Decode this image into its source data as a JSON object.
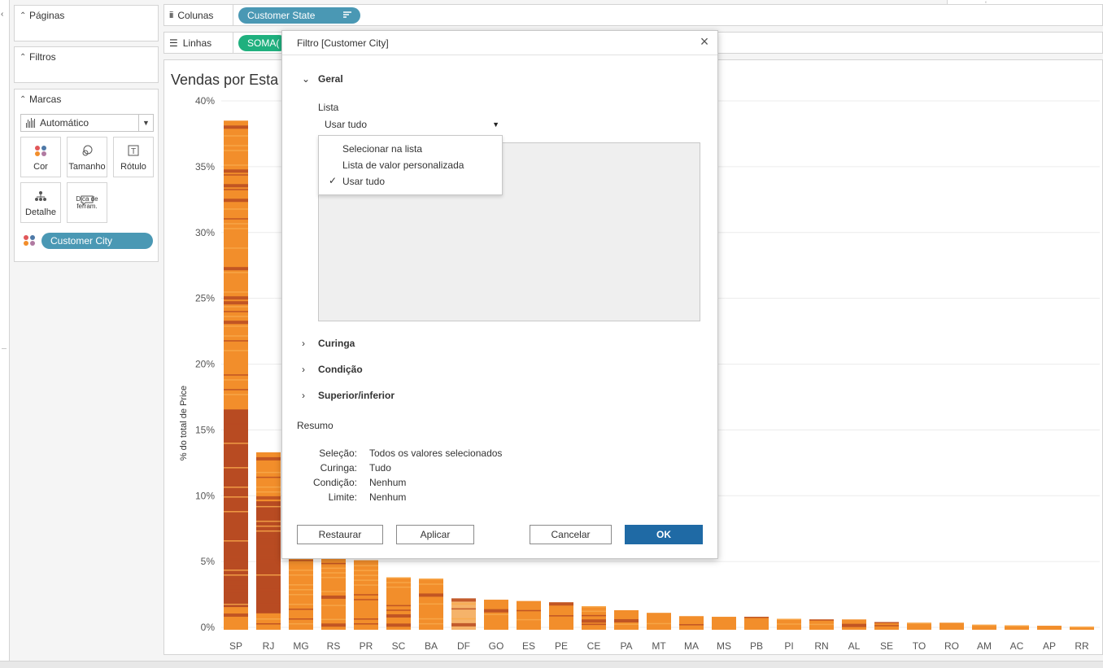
{
  "cards": {
    "pages": {
      "label": "Páginas"
    },
    "filters": {
      "label": "Filtros"
    },
    "marks": {
      "label": "Marcas",
      "type": "Automático",
      "buttons": {
        "color": "Cor",
        "size": "Tamanho",
        "label": "Rótulo",
        "detail": "Detalhe",
        "tooltip": "Dica de ferram."
      },
      "color_field": "Customer City"
    }
  },
  "shelves": {
    "columns": {
      "label": "Colunas",
      "pill": "Customer State"
    },
    "rows": {
      "label": "Linhas",
      "pill": "SOMA("
    }
  },
  "view": {
    "title": "Vendas por Esta",
    "ylabel": "% do total de Price"
  },
  "chart_data": {
    "type": "bar",
    "title": "",
    "xlabel": "",
    "ylabel": "% do total de Price",
    "ylim": [
      0,
      40
    ],
    "yticks": [
      "0%",
      "5%",
      "10%",
      "15%",
      "20%",
      "25%",
      "30%",
      "35%",
      "40%"
    ],
    "categories": [
      "SP",
      "RJ",
      "MG",
      "RS",
      "PR",
      "SC",
      "BA",
      "DF",
      "GO",
      "ES",
      "PE",
      "CE",
      "PA",
      "MT",
      "MA",
      "MS",
      "PB",
      "PI",
      "RN",
      "AL",
      "SE",
      "TO",
      "RO",
      "AM",
      "AC",
      "AP",
      "RR"
    ],
    "values": [
      38.5,
      13.3,
      11.8,
      5.6,
      5.1,
      3.8,
      3.7,
      2.2,
      2.1,
      2.0,
      1.9,
      1.6,
      1.3,
      1.1,
      0.85,
      0.8,
      0.8,
      0.65,
      0.6,
      0.6,
      0.4,
      0.35,
      0.35,
      0.2,
      0.15,
      0.12,
      0.05
    ],
    "colors": {
      "light": "#f8a94b",
      "mid": "#f28e2b",
      "dark": "#b84b22",
      "highlight": "#f5b36a"
    },
    "grid": true,
    "legend": "none"
  },
  "dialog": {
    "title": "Filtro [Customer City]",
    "sections": {
      "general": "Geral",
      "wildcard": "Curinga",
      "condition": "Condição",
      "topbottom": "Superior/inferior"
    },
    "list_label": "Lista",
    "list_value": "Usar tudo",
    "menu": [
      "Selecionar na lista",
      "Lista de valor personalizada",
      "Usar tudo"
    ],
    "summary_label": "Resumo",
    "summary": [
      {
        "key": "Seleção:",
        "value": "Todos os valores selecionados"
      },
      {
        "key": "Curinga:",
        "value": "Tudo"
      },
      {
        "key": "Condição:",
        "value": "Nenhum"
      },
      {
        "key": "Limite:",
        "value": "Nenhum"
      }
    ],
    "buttons": {
      "reset": "Restaurar",
      "apply": "Aplicar",
      "cancel": "Cancelar",
      "ok": "OK"
    }
  }
}
